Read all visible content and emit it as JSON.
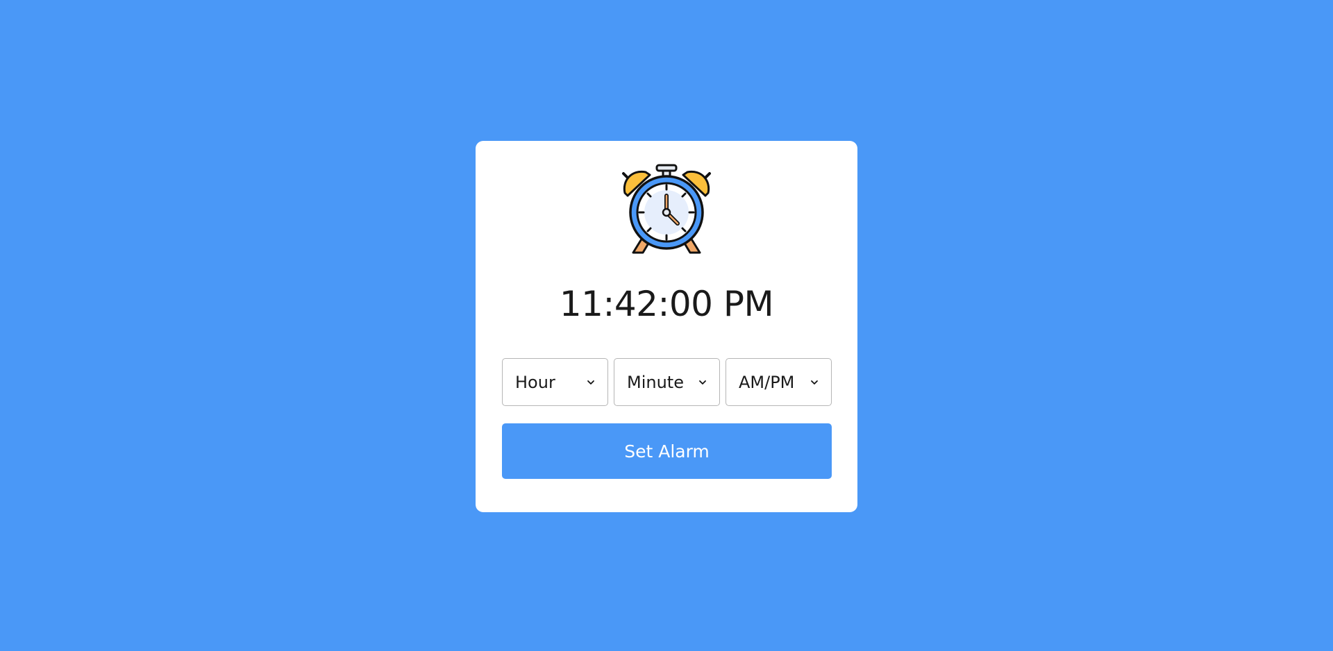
{
  "clock": {
    "time": "11:42:00 PM"
  },
  "selects": {
    "hour": {
      "value": "Hour",
      "icon": "chevron-down-icon"
    },
    "minute": {
      "value": "Minute",
      "icon": "chevron-down-icon"
    },
    "ampm": {
      "value": "AM/PM",
      "icon": "chevron-down-icon"
    }
  },
  "button": {
    "label": "Set Alarm"
  },
  "icons": {
    "main": "alarm-clock-icon"
  },
  "colors": {
    "background": "#4a98f7",
    "card": "#ffffff",
    "accent": "#4a98f7",
    "bell": "#fbbf3b"
  }
}
